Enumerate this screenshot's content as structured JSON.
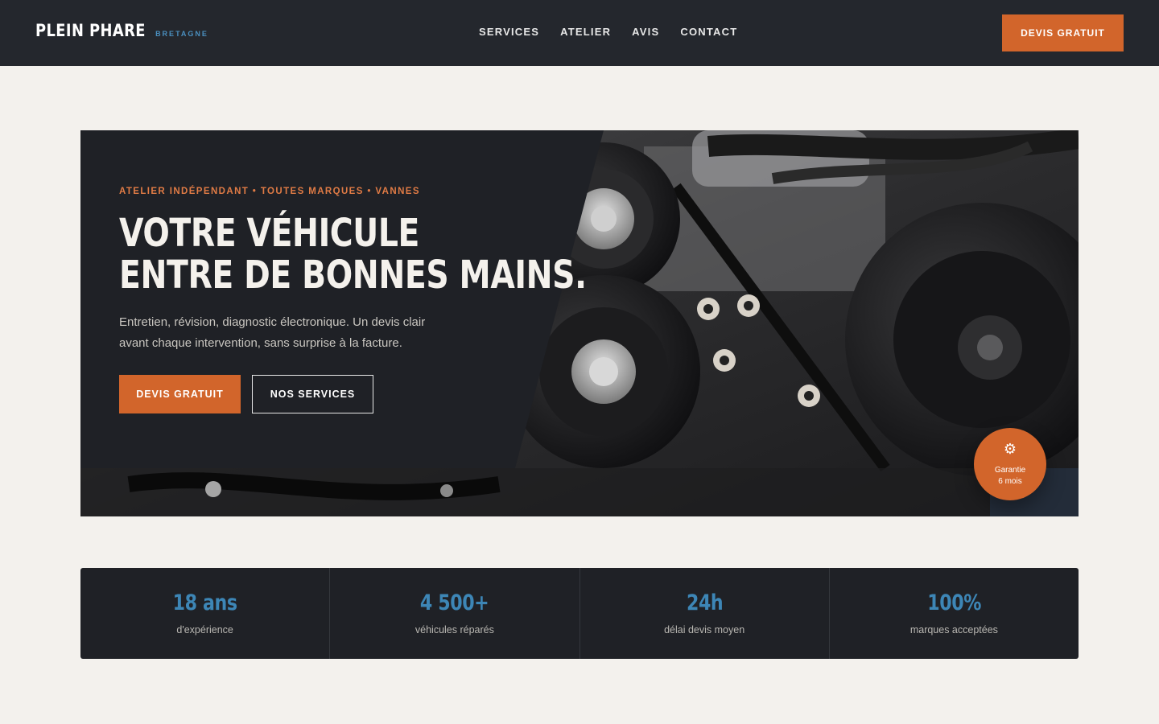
{
  "nav": {
    "brand_name": "PLEIN PHARE",
    "brand_sub": "BRETAGNE",
    "links": [
      "SERVICES",
      "ATELIER",
      "AVIS",
      "CONTACT"
    ],
    "cta": "DEVIS GRATUIT"
  },
  "hero": {
    "eyebrow": "ATELIER INDÉPENDANT • TOUTES MARQUES • VANNES",
    "headline_line1": "VOTRE VÉHICULE",
    "headline_line2": "ENTRE DE BONNES MAINS.",
    "lead": "Entretien, révision, diagnostic électronique. Un devis clair avant chaque intervention, sans surprise à la facture.",
    "primary_cta": "DEVIS GRATUIT",
    "secondary_cta": "NOS SERVICES",
    "badge": {
      "icon": "gear-icon",
      "line1": "Garantie",
      "line2": "6 mois"
    }
  },
  "stats": [
    {
      "value": "18 ans",
      "label": "d'expérience"
    },
    {
      "value": "4 500+",
      "label": "véhicules réparés"
    },
    {
      "value": "24h",
      "label": "délai devis moyen"
    },
    {
      "value": "100%",
      "label": "marques acceptées"
    }
  ],
  "colors": {
    "accent": "#d2652b",
    "stat_blue": "#3d86b6",
    "dark": "#1f2126",
    "background": "#f3f1ed"
  }
}
